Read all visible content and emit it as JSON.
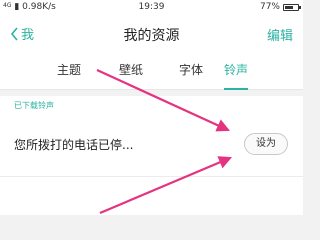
{
  "status_bar": {
    "network_label": "4G",
    "speed": "0.98K/s",
    "time": "19:39",
    "battery_percent": "77%",
    "battery_level": 0.77
  },
  "header": {
    "back_label": "我",
    "title": "我的资源",
    "edit_label": "编辑"
  },
  "tabs": [
    {
      "label": "主题",
      "active": false
    },
    {
      "label": "壁纸",
      "active": false
    },
    {
      "label": "字体",
      "active": false
    },
    {
      "label": "铃声",
      "active": true
    }
  ],
  "section": {
    "label": "已下载铃声"
  },
  "ringtones": [
    {
      "name": "您所拨打的电话已停...",
      "set_label": "设为"
    }
  ],
  "colors": {
    "accent": "#2ab3a0",
    "annotation_arrow": "#e5337f"
  },
  "icons": {
    "back": "chevron-left-icon",
    "battery": "battery-icon"
  }
}
